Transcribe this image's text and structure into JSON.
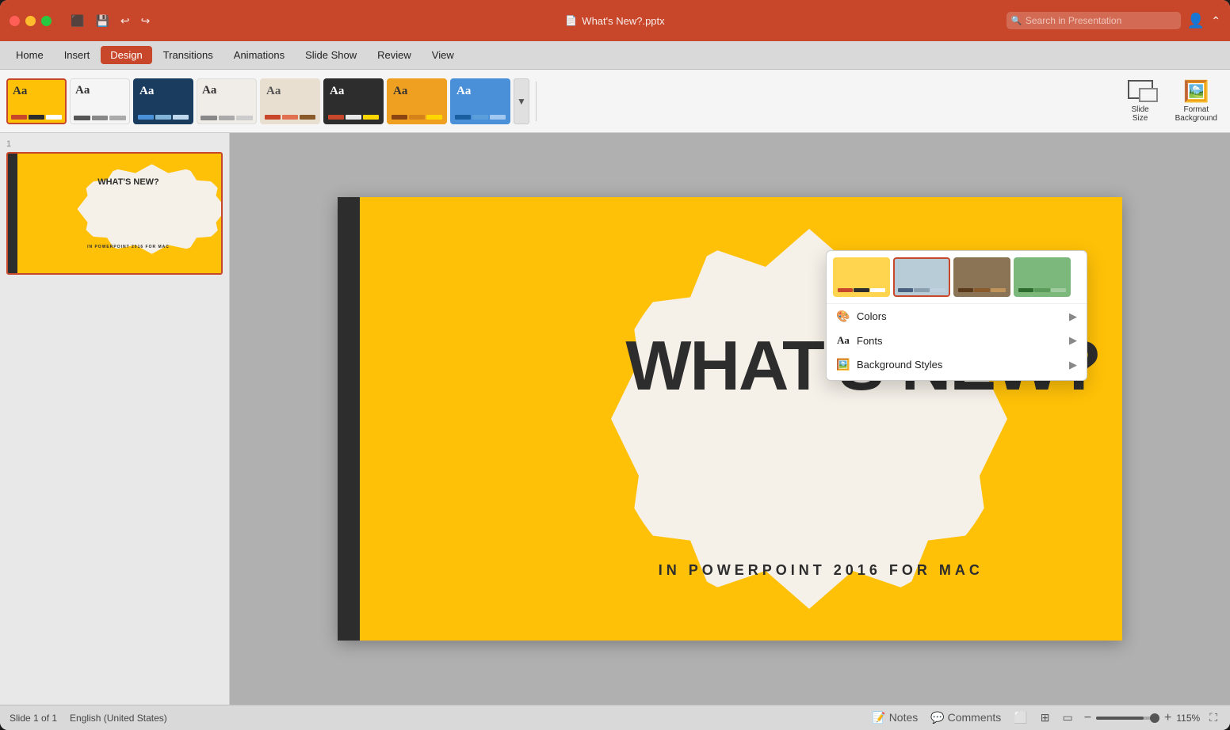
{
  "window": {
    "title": "What's New?.pptx",
    "titlebar_icon": "📄"
  },
  "traffic_lights": {
    "close": "close",
    "minimize": "minimize",
    "maximize": "maximize"
  },
  "search": {
    "placeholder": "Search in Presentation",
    "value": ""
  },
  "menubar": {
    "items": [
      {
        "label": "Home",
        "active": false
      },
      {
        "label": "Insert",
        "active": false
      },
      {
        "label": "Design",
        "active": true
      },
      {
        "label": "Transitions",
        "active": false
      },
      {
        "label": "Animations",
        "active": false
      },
      {
        "label": "Slide Show",
        "active": false
      },
      {
        "label": "Review",
        "active": false
      },
      {
        "label": "View",
        "active": false
      }
    ]
  },
  "ribbon": {
    "themes": [
      {
        "id": 1,
        "label": "Aa",
        "bg": "#ffc107",
        "text": "#333",
        "selected": true
      },
      {
        "id": 2,
        "label": "Aa",
        "bg": "#f5f5f5",
        "text": "#333",
        "selected": false
      },
      {
        "id": 3,
        "label": "Aa",
        "bg": "#1a3c5e",
        "text": "#fff",
        "selected": false
      },
      {
        "id": 4,
        "label": "Aa",
        "bg": "#f0ede8",
        "text": "#333",
        "selected": false
      },
      {
        "id": 5,
        "label": "Aa",
        "bg": "#e8dfd0",
        "text": "#555",
        "selected": false
      },
      {
        "id": 6,
        "label": "Aa",
        "bg": "#2d2d2d",
        "text": "#fff",
        "selected": false
      },
      {
        "id": 7,
        "label": "Aa",
        "bg": "#f0a020",
        "text": "#333",
        "selected": false
      },
      {
        "id": 8,
        "label": "Aa",
        "bg": "#4a90d9",
        "text": "#fff",
        "selected": false
      }
    ],
    "actions": [
      {
        "id": "slide-size",
        "label": "Slide\nSize",
        "icon": "⬜"
      },
      {
        "id": "format-bg",
        "label": "Format\nBackground",
        "icon": "🖼️"
      }
    ]
  },
  "slide": {
    "number": "1",
    "main_title": "WHAT'S NEW?",
    "subtitle": "IN POWERPOINT 2016 FOR MAC"
  },
  "dropdown": {
    "variants": [
      {
        "id": 1,
        "bg": "#ffd54f",
        "selected": false
      },
      {
        "id": 2,
        "bg": "#b0c4d8",
        "selected": true
      },
      {
        "id": 3,
        "bg": "#8b7355",
        "selected": false
      },
      {
        "id": 4,
        "bg": "#7cb87c",
        "selected": false
      }
    ],
    "menu_items": [
      {
        "id": "colors",
        "label": "Colors",
        "icon": "🎨",
        "has_arrow": true
      },
      {
        "id": "fonts",
        "label": "Fonts",
        "icon": "Aa",
        "has_arrow": true
      },
      {
        "id": "bg-styles",
        "label": "Background Styles",
        "icon": "🖼️",
        "has_arrow": true
      }
    ]
  },
  "statusbar": {
    "slide_info": "Slide 1 of 1",
    "language": "English (United States)",
    "notes_label": "Notes",
    "comments_label": "Comments",
    "zoom_value": "115%"
  }
}
